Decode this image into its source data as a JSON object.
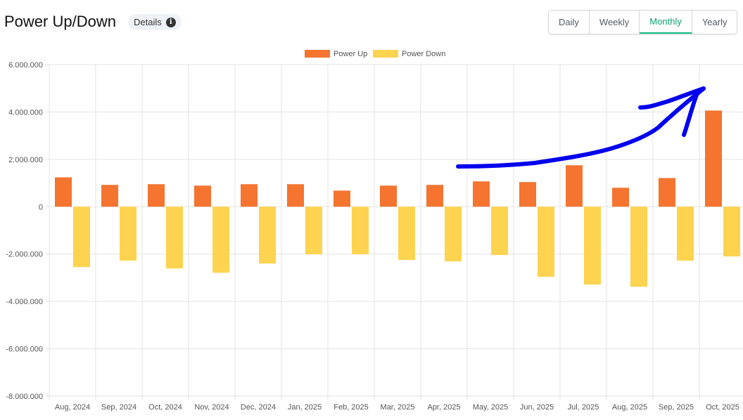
{
  "header": {
    "title": "Power Up/Down",
    "details_label": "Details",
    "info_icon": "i"
  },
  "tabs": [
    {
      "label": "Daily"
    },
    {
      "label": "Weekly"
    },
    {
      "label": "Monthly",
      "active": true
    },
    {
      "label": "Yearly"
    }
  ],
  "colors": {
    "up": "#f47430",
    "down": "#fdd34f",
    "annotation": "#0000ee",
    "active_tab": "#10b981"
  },
  "chart_data": {
    "type": "bar",
    "title": "",
    "xlabel": "",
    "ylabel": "",
    "legend_position": "top-center",
    "grid": true,
    "ylim": [
      -8000000,
      6000000
    ],
    "yticks": [
      {
        "v": 6000000,
        "label": "6.000.000"
      },
      {
        "v": 4000000,
        "label": "4.000.000"
      },
      {
        "v": 2000000,
        "label": "2.000.000"
      },
      {
        "v": 0,
        "label": "0"
      },
      {
        "v": -2000000,
        "label": "-2.000.000"
      },
      {
        "v": -4000000,
        "label": "-4.000.000"
      },
      {
        "v": -6000000,
        "label": "-6.000.000"
      },
      {
        "v": -8000000,
        "label": "-8.000.000"
      }
    ],
    "categories": [
      "Aug, 2024",
      "Sep, 2024",
      "Oct, 2024",
      "Nov, 2024",
      "Dec, 2024",
      "Jan, 2025",
      "Feb, 2025",
      "Mar, 2025",
      "Apr, 2025",
      "May, 2025",
      "Jun, 2025",
      "Jul, 2025",
      "Aug, 2025",
      "Sep, 2025",
      "Oct, 2025"
    ],
    "series": [
      {
        "name": "Power Up",
        "values": [
          1240000,
          920000,
          950000,
          890000,
          950000,
          950000,
          680000,
          890000,
          920000,
          1070000,
          1040000,
          1750000,
          800000,
          1210000,
          4060000
        ]
      },
      {
        "name": "Power Down",
        "values": [
          -2550000,
          -2280000,
          -2610000,
          -2790000,
          -2400000,
          -2010000,
          -2010000,
          -2250000,
          -2310000,
          -2040000,
          -2960000,
          -3290000,
          -3380000,
          -2280000,
          -2100000
        ]
      }
    ],
    "annotations": [
      {
        "type": "hand-drawn arrow",
        "description": "upward trend arrow pointing to Oct, 2025"
      }
    ]
  }
}
